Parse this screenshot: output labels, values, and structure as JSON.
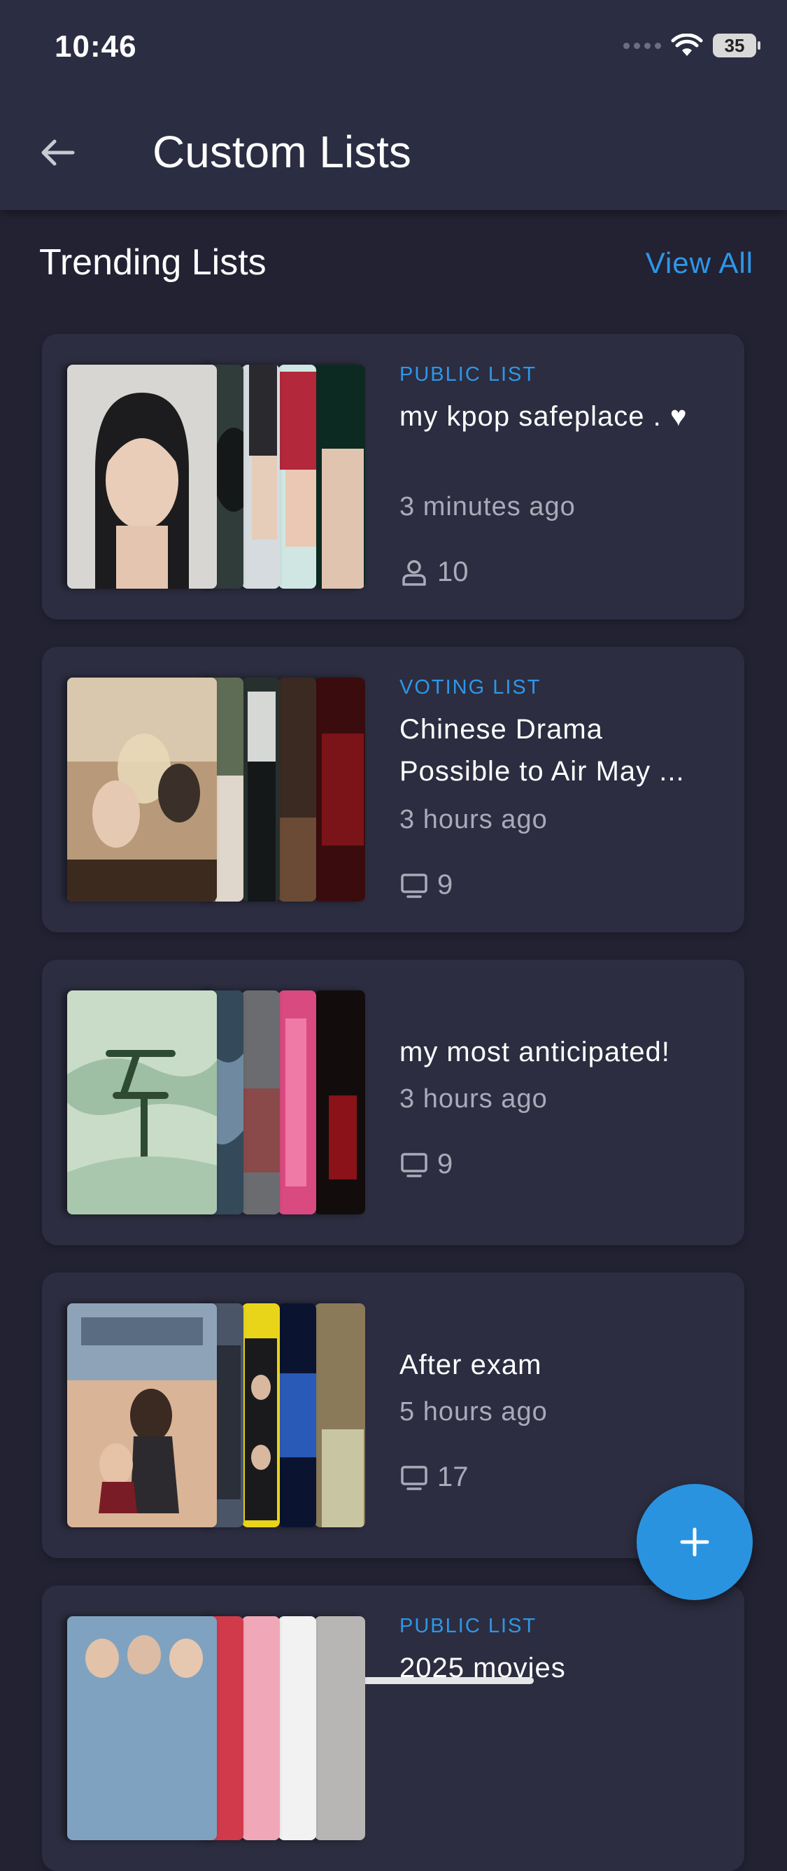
{
  "status_bar": {
    "time": "10:46",
    "battery": "35"
  },
  "header": {
    "title": "Custom Lists"
  },
  "section": {
    "title": "Trending Lists",
    "view_all_label": "View All"
  },
  "lists": [
    {
      "type": "PUBLIC LIST",
      "title": "my kpop safeplace . ♥",
      "time": "3 minutes ago",
      "stat_icon": "user-icon",
      "count": "10"
    },
    {
      "type": "VOTING LIST",
      "title": "Chinese Drama Possible to Air May ...",
      "time": "3 hours ago",
      "stat_icon": "tv-icon",
      "count": "9"
    },
    {
      "type": "",
      "title": "my most anticipated!",
      "time": "3 hours ago",
      "stat_icon": "tv-icon",
      "count": "9"
    },
    {
      "type": "",
      "title": "After exam",
      "time": "5 hours ago",
      "stat_icon": "tv-icon",
      "count": "17"
    },
    {
      "type": "PUBLIC LIST",
      "title": "2025 movies",
      "time": "",
      "stat_icon": "",
      "count": ""
    }
  ],
  "fab": {
    "icon": "plus-icon"
  },
  "colors": {
    "accent": "#2d97e8",
    "background": "#222233",
    "card": "#2c2d40",
    "header": "#2b2e42"
  }
}
